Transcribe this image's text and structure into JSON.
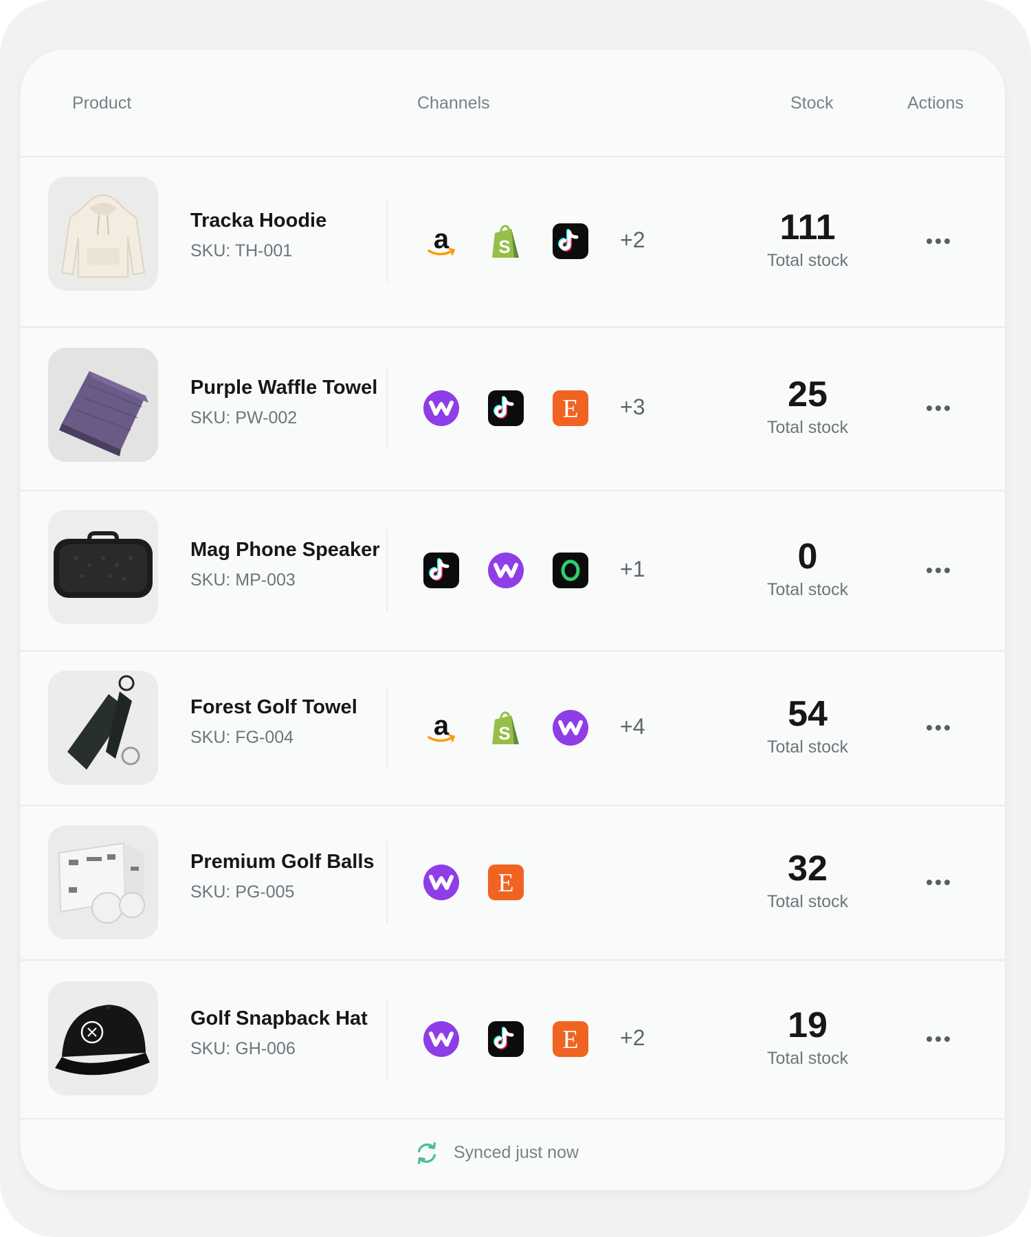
{
  "header": {
    "product": "Product",
    "channels": "Channels",
    "stock": "Stock",
    "actions": "Actions"
  },
  "rows": [
    {
      "name": "Tracka Hoodie",
      "sku": "SKU: TH-001",
      "image": "hoodie-image",
      "channels": [
        "amazon-icon",
        "shopify-icon",
        "tiktok-icon"
      ],
      "more": "+2",
      "stock": "111",
      "stock_label": "Total stock"
    },
    {
      "name": "Purple Waffle Towel",
      "sku": "SKU: PW-002",
      "image": "towel-image",
      "channels": [
        "walmart-icon",
        "tiktok-icon",
        "etsy-icon"
      ],
      "more": "+3",
      "stock": "25",
      "stock_label": "Total stock"
    },
    {
      "name": "Mag Phone Speaker",
      "sku": "SKU: MP-003",
      "image": "speaker-image",
      "channels": [
        "tiktok-icon",
        "walmart-icon",
        "o-icon"
      ],
      "more": "+1",
      "stock": "0",
      "stock_label": "Total stock"
    },
    {
      "name": "Forest Golf Towel",
      "sku": "SKU: FG-004",
      "image": "golf-towel-image",
      "channels": [
        "amazon-icon",
        "shopify-icon",
        "walmart-icon"
      ],
      "more": "+4",
      "stock": "54",
      "stock_label": "Total stock"
    },
    {
      "name": "Premium Golf Balls",
      "sku": "SKU: PG-005",
      "image": "golf-balls-image",
      "channels": [
        "walmart-icon",
        "etsy-icon"
      ],
      "more": "",
      "stock": "32",
      "stock_label": "Total stock"
    },
    {
      "name": "Golf Snapback Hat",
      "sku": "SKU: GH-006",
      "image": "hat-image",
      "channels": [
        "walmart-icon",
        "tiktok-icon",
        "etsy-icon"
      ],
      "more": "+2",
      "stock": "19",
      "stock_label": "Total stock"
    }
  ],
  "footer": {
    "sync_text": "Synced just now"
  },
  "colors": {
    "walmart": "#8f3de6",
    "etsy": "#f06321",
    "shopify": "#95bf47",
    "amazon_smile": "#ff9900",
    "sync": "#4cbf8f"
  }
}
